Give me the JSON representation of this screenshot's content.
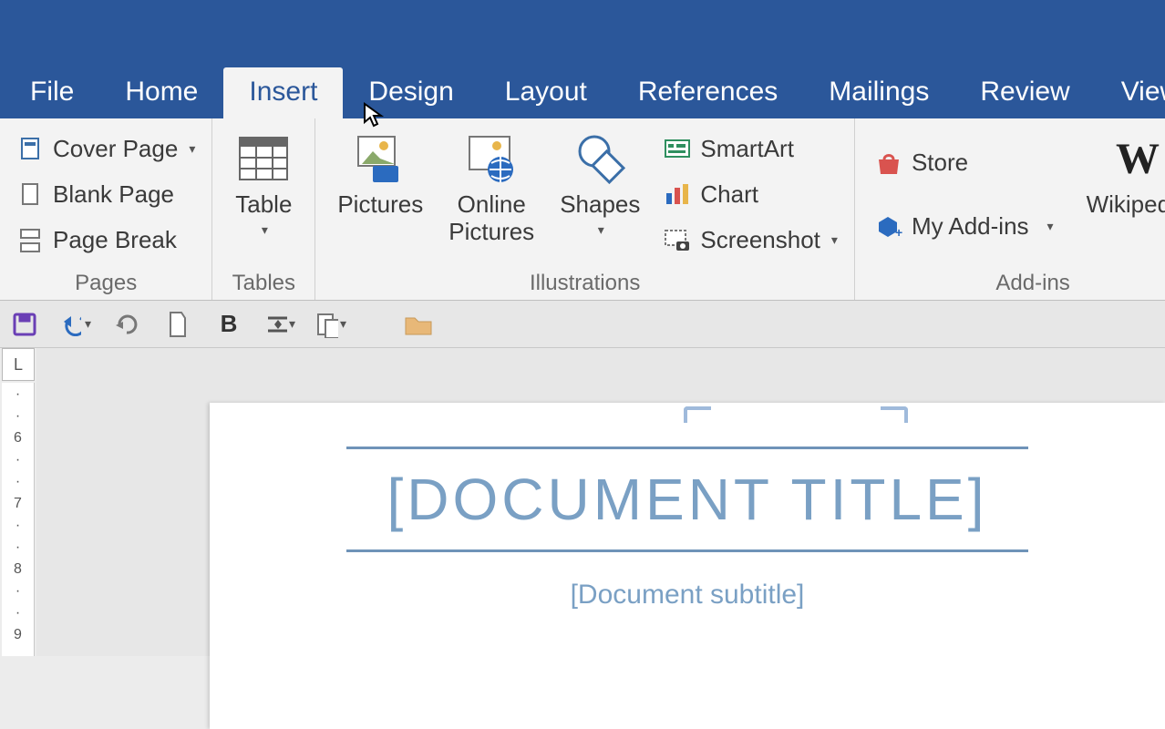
{
  "tabs": {
    "file": "File",
    "home": "Home",
    "insert": "Insert",
    "design": "Design",
    "layout": "Layout",
    "references": "References",
    "mailings": "Mailings",
    "review": "Review",
    "view": "View"
  },
  "active_tab": "insert",
  "ribbon": {
    "pages": {
      "label": "Pages",
      "cover_page": "Cover Page",
      "blank_page": "Blank Page",
      "page_break": "Page Break"
    },
    "tables": {
      "label": "Tables",
      "table": "Table"
    },
    "illustrations": {
      "label": "Illustrations",
      "pictures": "Pictures",
      "online_pictures_l1": "Online",
      "online_pictures_l2": "Pictures",
      "shapes": "Shapes",
      "smartart": "SmartArt",
      "chart": "Chart",
      "screenshot": "Screenshot"
    },
    "addins": {
      "label": "Add-ins",
      "store": "Store",
      "my_addins": "My Add-ins",
      "wikipedia": "Wikipedia"
    }
  },
  "ruler": {
    "corner": "L",
    "marks": [
      "·",
      "·",
      "6",
      "·",
      "·",
      "7",
      "·",
      "·",
      "8",
      "·",
      "·",
      "9"
    ]
  },
  "document": {
    "title": "[DOCUMENT TITLE]",
    "subtitle": "[Document subtitle]"
  }
}
